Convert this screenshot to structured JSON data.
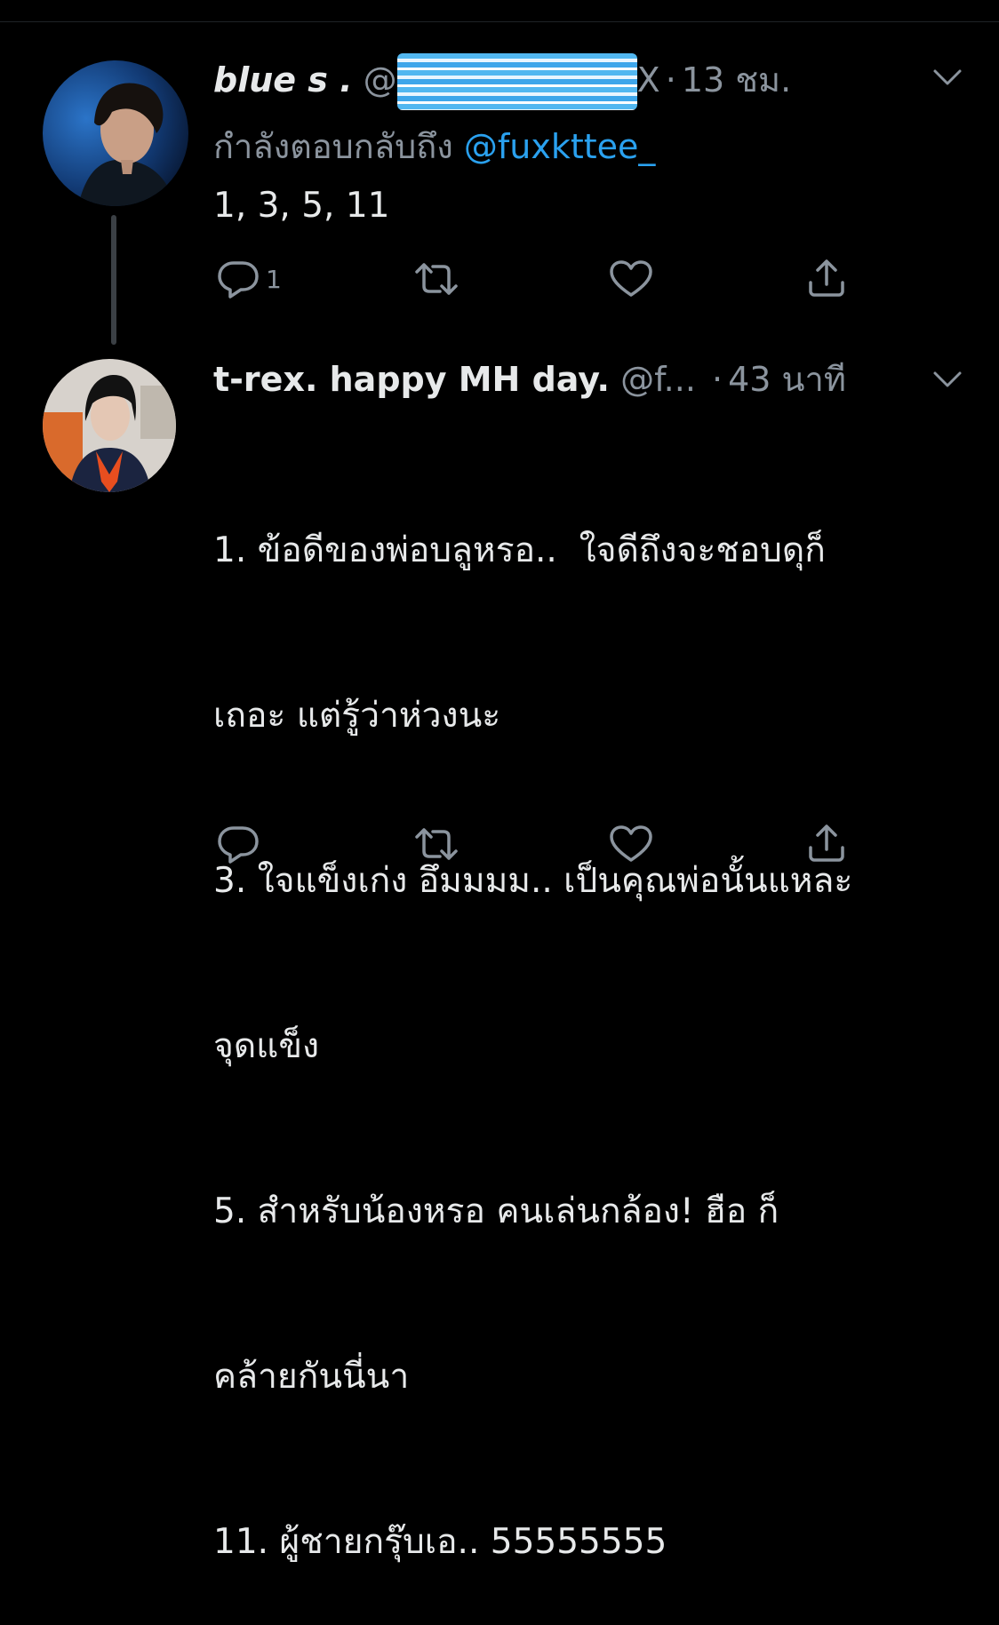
{
  "tweets": [
    {
      "name": "blue s .",
      "handle_start": "@",
      "handle_end": "X",
      "dot": "·",
      "time": "13 ชม.",
      "replying_prefix": "กำลังตอบกลับถึง",
      "replying_mention": "@fuxkttee_",
      "text": "1, 3, 5, 11",
      "actions": {
        "reply_count": "1",
        "retweet_count": "",
        "like_count": ""
      },
      "icons": [
        "reply-icon",
        "retweet-icon",
        "like-icon",
        "share-icon",
        "chevron-down-icon"
      ]
    },
    {
      "name": "t-rex. happy MH day.",
      "handle": "@f...",
      "dot": "·",
      "time": "43 นาที",
      "lines": [
        "1. ข้อดีของพ่อบลูหรอ..  ใจดีถึงจะชอบดุก็",
        "เถอะ แต่รู้ว่าห่วงนะ",
        "3. ใจแข็งเก่ง อึมมมม.. เป็นคุณพ่อนั้นแหละ",
        "จุดแข็ง",
        "5. สำหรับน้องหรอ คนเล่นกล้อง! ฮือ ก็",
        "คล้ายกันนี่นา",
        "11. ผู้ชายกรุ๊บเอ.. 55555555"
      ]
    }
  ],
  "colors": {
    "background": "#000000",
    "text": "#e7e9ea",
    "muted": "#8b949e",
    "mention": "#2aa1ef"
  }
}
